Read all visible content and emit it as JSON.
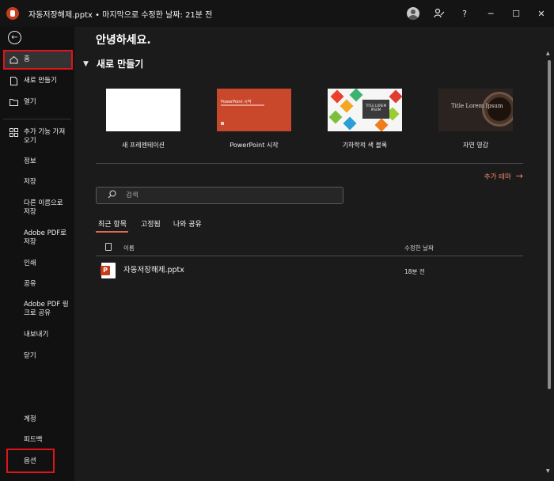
{
  "titlebar": {
    "title": "자동저장해제.pptx • 마지막으로 수정한 날짜: 21분 전",
    "help": "?",
    "minimize": "─",
    "maximize": "☐",
    "close": "✕"
  },
  "sidebar": {
    "back": "←",
    "home": "홈",
    "new": "새로 만들기",
    "open": "열기",
    "addins": "추가 기능 가져오기",
    "info": "정보",
    "save": "저장",
    "save_as": "다른 이름으로 저장",
    "save_pdf": "Adobe PDF로 저장",
    "print": "인쇄",
    "share": "공유",
    "adobe_link": "Adobe PDF 링크로 공유",
    "export": "내보내기",
    "close": "닫기",
    "account": "계정",
    "feedback": "피드백",
    "options": "옵션"
  },
  "main": {
    "greeting": "안녕하세요.",
    "new_section": "새로 만들기",
    "templates": [
      {
        "name": "새 프레젠테이션"
      },
      {
        "name": "PowerPoint 시작",
        "thumb_title": "PowerPoint 시작"
      },
      {
        "name": "기하학적 색 블록",
        "thumb_title": "TITLE LOREM IPSUM"
      },
      {
        "name": "자연 영감",
        "thumb_title": "Title Lorem Ipsum"
      }
    ],
    "more_themes": "추가 테마",
    "search_placeholder": "검색",
    "tabs": [
      "최근 항목",
      "고정됨",
      "나와 공유"
    ],
    "columns": {
      "name": "이름",
      "date": "수정한 날짜"
    },
    "files": [
      {
        "name": "자동저장해제.pptx",
        "date": "18분 전"
      }
    ]
  },
  "colors": {
    "accent": "#e06a4e",
    "highlight_box": "#e0141b",
    "powerpoint": "#c43e1c"
  }
}
